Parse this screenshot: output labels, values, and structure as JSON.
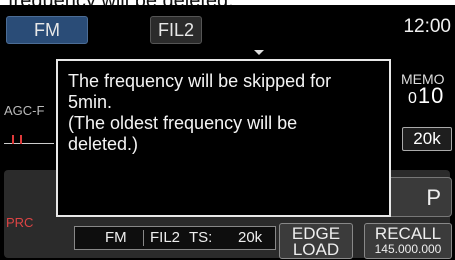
{
  "caption": "frequency will be deleted.",
  "top": {
    "mode": "FM",
    "filter": "FIL2",
    "clock": "12:00"
  },
  "left": {
    "agc": "AGC-F",
    "prc": "PRC"
  },
  "memo": {
    "label": "MEMO",
    "channel_small": "0",
    "channel": "10",
    "step": "20k"
  },
  "dialog": {
    "lines": [
      "The frequency will be skipped for",
      "5min.",
      "(The oldest frequency will be",
      "deleted.)"
    ]
  },
  "bottom": {
    "op_label": "P",
    "status": {
      "mode": "FM",
      "filter": "FIL2",
      "ts_label": "TS:",
      "ts_value": "20k"
    },
    "edge_line1": "EDGE",
    "edge_line2": "LOAD",
    "recall_label": "RECALL",
    "recall_freq": "145.000.000"
  },
  "colors": {
    "accent_blue": "#2a4c77",
    "meter_red": "#e03a3a",
    "prc_red": "#d44"
  }
}
